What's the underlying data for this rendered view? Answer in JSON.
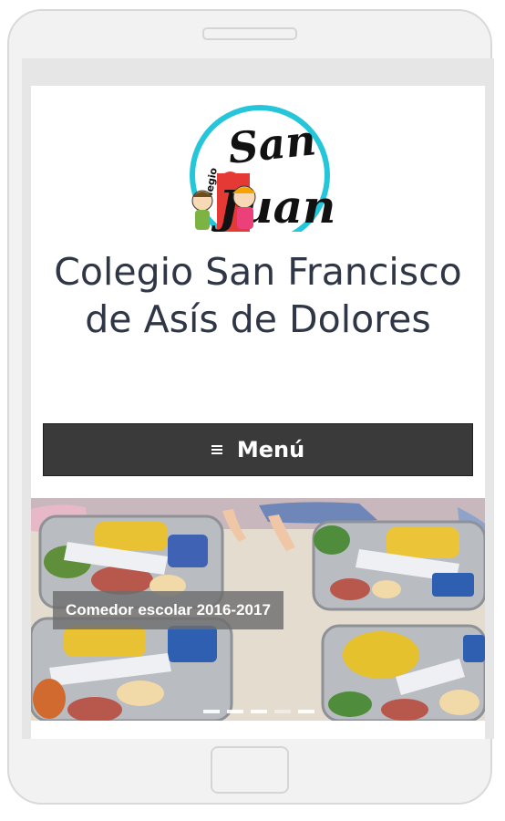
{
  "site": {
    "title": "Colegio San Francisco de Asís de Dolores",
    "logo_name": "logo-san-juan",
    "logo_text_top": "San",
    "logo_text_bottom": "Juan",
    "logo_side_text": "Colegio"
  },
  "menu": {
    "label": "Menú",
    "icon": "hamburger-icon"
  },
  "slider": {
    "caption": "Comedor escolar 2016-2017",
    "slide_count": 5,
    "active_index": 3
  },
  "colors": {
    "title": "#2f3645",
    "menu_bg": "#3a3a3a",
    "logo_ring": "#26c6da",
    "logo_red": "#e53935"
  }
}
